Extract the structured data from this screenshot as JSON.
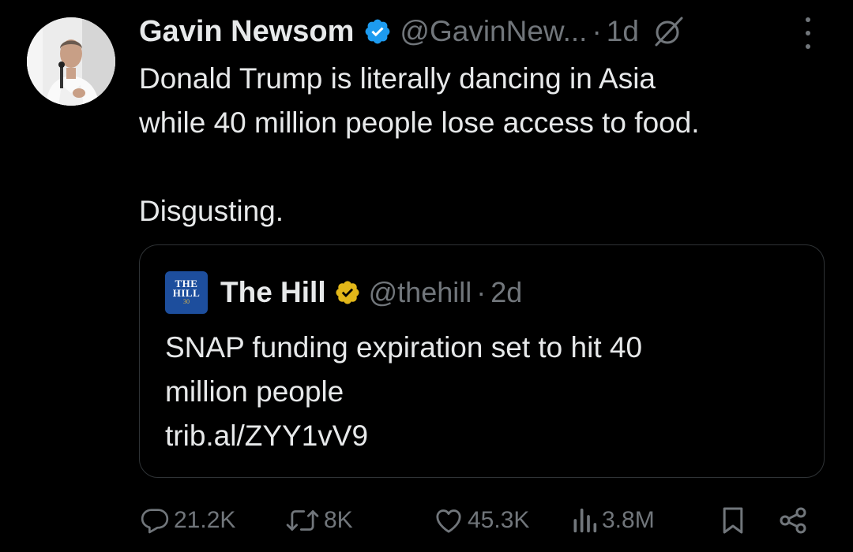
{
  "tweet": {
    "author": "Gavin Newsom",
    "handle": "@GavinNew...",
    "separator": "·",
    "time": "1d",
    "text": "Donald Trump is literally dancing in Asia\nwhile 40 million people lose access to food.\n\nDisgusting."
  },
  "quote": {
    "logo_line1": "THE",
    "logo_line2": "HILL",
    "logo_line3": "30",
    "author": "The Hill",
    "handle": "@thehill",
    "separator": "·",
    "time": "2d",
    "text": "SNAP funding expiration set to hit 40\nmillion people\ntrib.al/ZYY1vV9"
  },
  "actions": {
    "replies": "21.2K",
    "reposts": "8K",
    "likes": "45.3K",
    "views": "3.8M"
  },
  "icons": {
    "verified_author": "verified-blue-badge-icon",
    "verified_quote": "verified-gold-badge-icon",
    "grok": "grok-icon",
    "more": "more-options-icon",
    "reply": "reply-icon",
    "repost": "repost-icon",
    "like": "like-icon",
    "views": "views-icon",
    "bookmark": "bookmark-icon",
    "share": "share-icon"
  },
  "colors": {
    "background": "#000000",
    "text": "#e7e9ea",
    "muted": "#71767b",
    "border": "#2f3336",
    "verified_blue": "#1d9bf0",
    "verified_gold": "#e2b719",
    "thehill_logo": "#1d4e9d"
  }
}
